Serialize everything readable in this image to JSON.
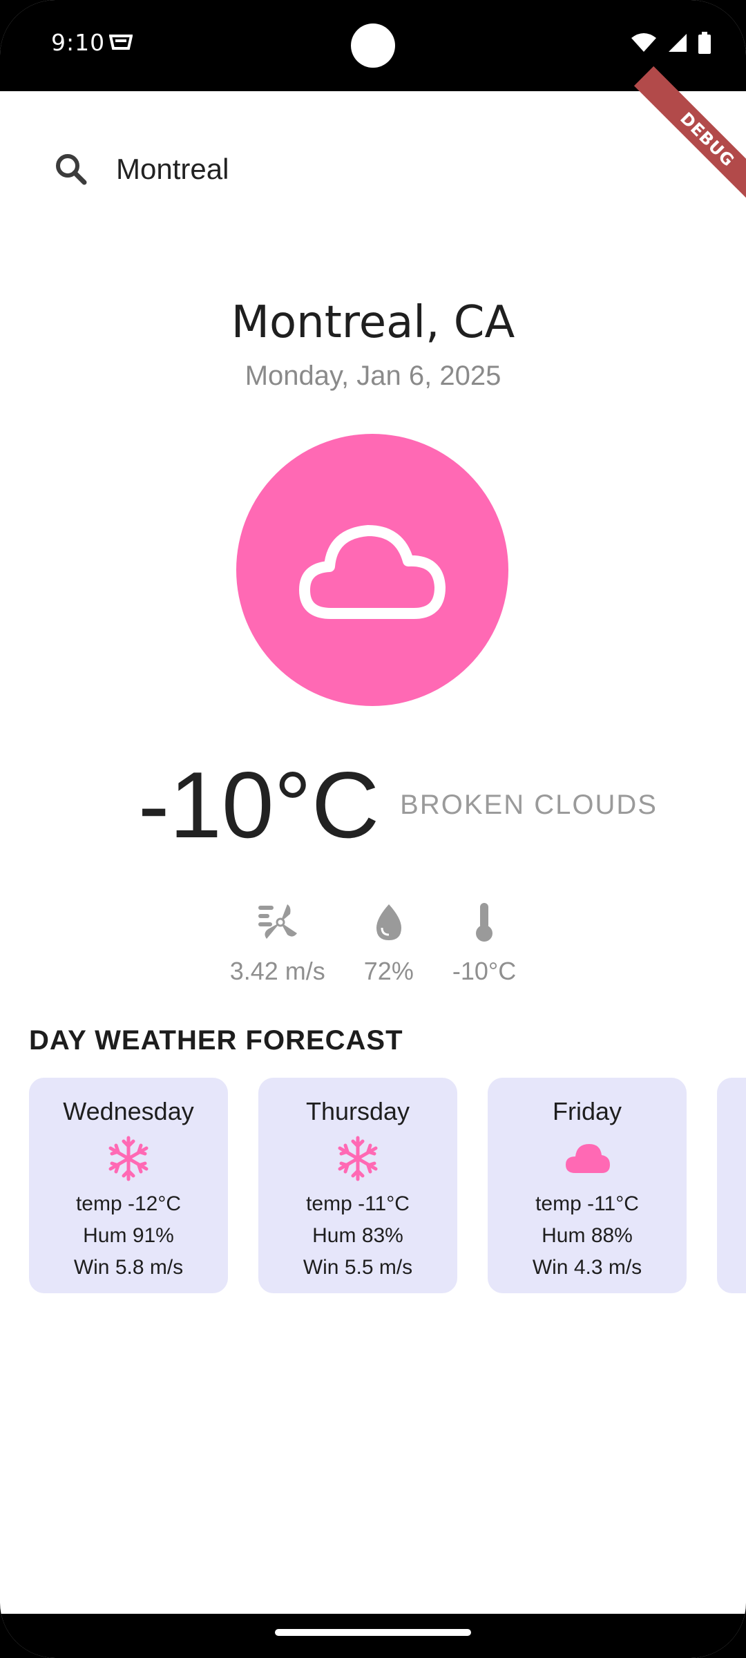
{
  "status_bar": {
    "time": "9:10"
  },
  "debug_label": "DEBUG",
  "search": {
    "query": "Montreal"
  },
  "location": {
    "title": "Montreal, CA",
    "date": "Monday, Jan 6, 2025"
  },
  "current": {
    "temperature": "-10°C",
    "description": "BROKEN CLOUDS",
    "icon": "cloud-icon",
    "accent_color": "#ff69b4"
  },
  "stats": {
    "wind": "3.42 m/s",
    "humidity": "72%",
    "feels_like": "-10°C"
  },
  "forecast": {
    "title": "DAY WEATHER FORECAST",
    "card_color": "#e6e6fa",
    "days": [
      {
        "day": "Wednesday",
        "icon": "snowflake-icon",
        "temp": "temp -12°C",
        "hum": "Hum 91%",
        "wind": "Win 5.8 m/s"
      },
      {
        "day": "Thursday",
        "icon": "snowflake-icon",
        "temp": "temp -11°C",
        "hum": "Hum 83%",
        "wind": "Win 5.5 m/s"
      },
      {
        "day": "Friday",
        "icon": "cloud-icon",
        "temp": "temp -11°C",
        "hum": "Hum 88%",
        "wind": "Win 4.3 m/s"
      }
    ]
  }
}
